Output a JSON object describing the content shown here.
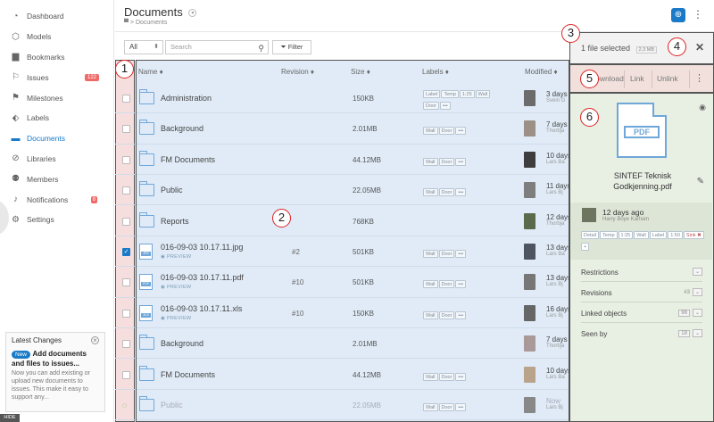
{
  "sidebar": {
    "items": [
      {
        "label": "Dashboard",
        "icon": "speedometer-icon"
      },
      {
        "label": "Models",
        "icon": "cube-icon"
      },
      {
        "label": "Bookmarks",
        "icon": "bookmark-icon"
      },
      {
        "label": "Issues",
        "icon": "flag-icon",
        "badge": "122"
      },
      {
        "label": "Milestones",
        "icon": "milestone-flag-icon"
      },
      {
        "label": "Labels",
        "icon": "tag-icon"
      },
      {
        "label": "Documents",
        "icon": "folder-icon",
        "active": true
      },
      {
        "label": "Libraries",
        "icon": "library-icon"
      },
      {
        "label": "Members",
        "icon": "people-icon"
      },
      {
        "label": "Notifications",
        "icon": "bell-icon",
        "badge": "8"
      },
      {
        "label": "Settings",
        "icon": "gear-icon"
      }
    ],
    "latest": {
      "title": "Latest Changes",
      "new_badge": "New",
      "headline": "Add documents and files to issues...",
      "body": "Now you can add existing or upload new documents to issues. This make it easy to support any..."
    },
    "hide_label": "HIDE"
  },
  "header": {
    "title": "Documents",
    "breadcrumb": "Documents"
  },
  "toolbar": {
    "select_value": "All",
    "search_placeholder": "Search",
    "filter_label": "Filter"
  },
  "table": {
    "columns": {
      "name": "Name ♦",
      "revision": "Revision ♦",
      "size": "Size ♦",
      "labels": "Labels ♦",
      "modified": "Modified ♦"
    },
    "rows": [
      {
        "type": "folder",
        "name": "Administration",
        "revision": "",
        "size": "150KB",
        "labels": [
          "Label",
          "Temp",
          "1:25",
          "Wall",
          "Door",
          "•••"
        ],
        "modified": "3 days",
        "by": "Svein G"
      },
      {
        "type": "folder",
        "name": "Background",
        "revision": "",
        "size": "2.01MB",
        "labels": [
          "Wall",
          "Door",
          "•••"
        ],
        "modified": "7 days",
        "by": "Thorbja"
      },
      {
        "type": "folder",
        "name": "FM Documents",
        "revision": "",
        "size": "44.12MB",
        "labels": [
          "Wall",
          "Door",
          "•••"
        ],
        "modified": "10 days",
        "by": "Lars Ba"
      },
      {
        "type": "folder",
        "name": "Public",
        "revision": "",
        "size": "22.05MB",
        "labels": [
          "Wall",
          "Door",
          "•••"
        ],
        "modified": "11 days",
        "by": "Lars Bj"
      },
      {
        "type": "folder",
        "name": "Reports",
        "revision": "",
        "size": "768KB",
        "labels": [],
        "modified": "12 days",
        "by": "Thorbja"
      },
      {
        "type": "file",
        "ext": "JPG",
        "name": "016-09-03 10.17.11.jpg",
        "preview": "PREVIEW",
        "revision": "#2",
        "size": "501KB",
        "labels": [
          "Wall",
          "Door",
          "•••"
        ],
        "modified": "13 days",
        "by": "Lars Ba",
        "checked": true
      },
      {
        "type": "file",
        "ext": "PDF",
        "name": "016-09-03 10.17.11.pdf",
        "preview": "PREVIEW",
        "revision": "#10",
        "size": "501KB",
        "labels": [
          "Wall",
          "Door",
          "•••"
        ],
        "modified": "13 days",
        "by": "Lars Bj"
      },
      {
        "type": "file",
        "ext": "XLS",
        "name": "016-09-03 10.17.11.xls",
        "preview": "PREVIEW",
        "revision": "#10",
        "size": "150KB",
        "labels": [
          "Wall",
          "Door",
          "•••"
        ],
        "modified": "16 days",
        "by": "Lars Bj"
      },
      {
        "type": "folder",
        "name": "Background",
        "revision": "",
        "size": "2.01MB",
        "labels": [],
        "modified": "7 days",
        "by": "Thorbja"
      },
      {
        "type": "folder",
        "name": "FM Documents",
        "revision": "",
        "size": "44.12MB",
        "labels": [
          "Wall",
          "Door",
          "•••"
        ],
        "modified": "10 days",
        "by": "Lars Ba"
      },
      {
        "type": "folder",
        "name": "Public",
        "revision": "",
        "size": "22.05MB",
        "labels": [
          "Wall",
          "Door",
          "•••"
        ],
        "modified": "Now",
        "by": "Lars Bj",
        "loading": true
      }
    ]
  },
  "panel": {
    "selected_text": "1 file selected",
    "selected_size": "2.3 MB",
    "actions": [
      "Download",
      "Link",
      "Unlink"
    ],
    "file_type": "PDF",
    "filename_line1": "SINTEF Teknisk",
    "filename_line2": "Godkjenning.pdf",
    "modified_when": "12 days ago",
    "modified_by": "Harry Boye Karlsen",
    "tags": [
      "Detail",
      "Temp",
      "1:25",
      "Wall",
      "Label",
      "1:50",
      "Sink ✖",
      "+"
    ],
    "sections": [
      {
        "label": "Restrictions",
        "value": ""
      },
      {
        "label": "Revisions",
        "value": "#3"
      },
      {
        "label": "Linked objects",
        "value": "98"
      },
      {
        "label": "Seen by",
        "value": "18"
      }
    ]
  },
  "markers": [
    "1",
    "2",
    "3",
    "4",
    "5",
    "6"
  ]
}
